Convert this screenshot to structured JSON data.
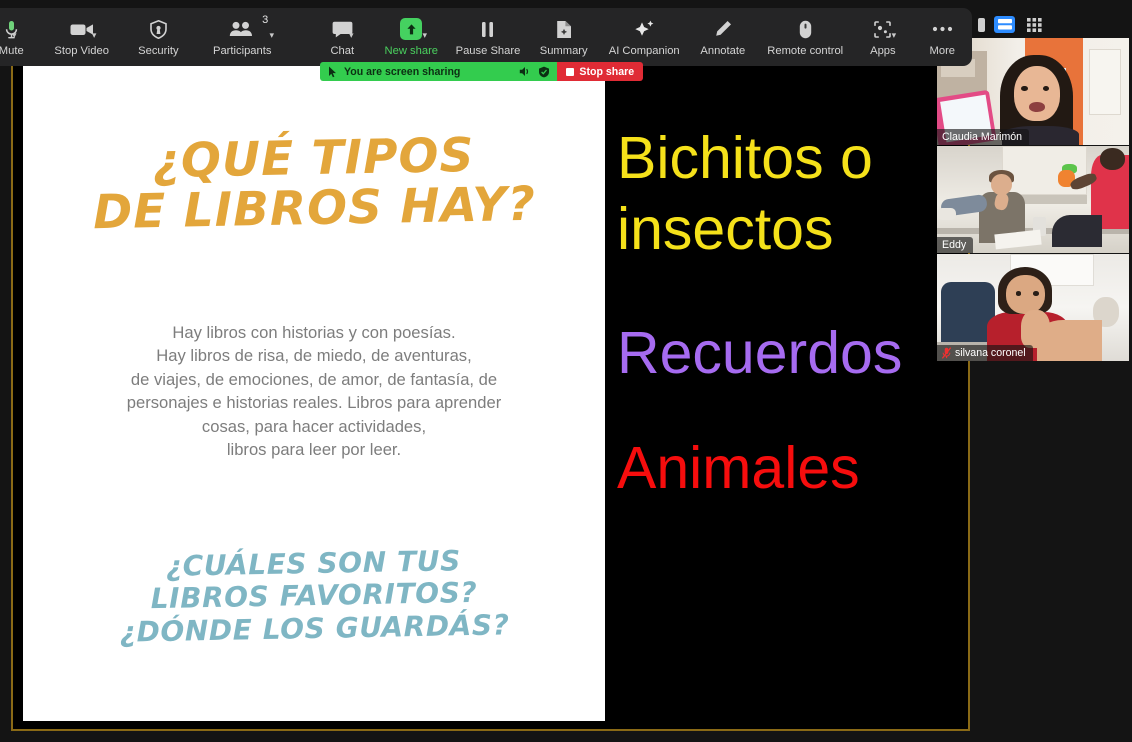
{
  "toolbar": {
    "items": [
      {
        "label": "Mute",
        "icon": "microphone-icon",
        "has_caret": true,
        "name": "mute"
      },
      {
        "label": "Stop Video",
        "icon": "video-camera-icon",
        "has_caret": true,
        "name": "stop-video"
      },
      {
        "label": "Security",
        "icon": "shield-icon",
        "has_caret": false,
        "name": "security"
      },
      {
        "label": "Participants",
        "icon": "people-icon",
        "has_caret": true,
        "badge": "3",
        "name": "participants"
      },
      {
        "label": "Chat",
        "icon": "chat-bubble-icon",
        "has_caret": true,
        "name": "chat"
      },
      {
        "label": "New share",
        "icon": "share-screen-icon",
        "has_caret": true,
        "highlight": true,
        "name": "new-share"
      },
      {
        "label": "Pause Share",
        "icon": "pause-icon",
        "has_caret": false,
        "name": "pause-share"
      },
      {
        "label": "Summary",
        "icon": "summary-document-icon",
        "has_caret": false,
        "name": "summary"
      },
      {
        "label": "AI Companion",
        "icon": "sparkle-icon",
        "has_caret": false,
        "name": "ai-companion"
      },
      {
        "label": "Annotate",
        "icon": "pencil-icon",
        "has_caret": false,
        "name": "annotate"
      },
      {
        "label": "Remote control",
        "icon": "mouse-icon",
        "has_caret": false,
        "name": "remote-control"
      },
      {
        "label": "Apps",
        "icon": "apps-icon",
        "has_caret": true,
        "name": "apps"
      },
      {
        "label": "More",
        "icon": "ellipsis-icon",
        "has_caret": false,
        "name": "more"
      }
    ]
  },
  "share_pill": {
    "status_text": "You are screen sharing",
    "stop_label": "Stop share"
  },
  "view_controls": {
    "speaker_view_label": "Speaker View",
    "gallery_view_label": "Gallery View",
    "active": "speaker",
    "accent_color": "#2d8cff"
  },
  "slide": {
    "title": "¿QUÉ TIPOS\nDE LIBROS HAY?",
    "title_color": "#e3a63b",
    "body": "Hay libros con historias y con poesías.\nHay libros de risa, de miedo, de aventuras,\nde viajes, de emociones, de amor, de fantasía, de\npersonajes e historias reales. Libros para aprender\ncosas, para hacer actividades,\nlibros para leer por leer.",
    "body_color": "#7d7d7d",
    "question": "¿CUÁLES SON TUS\nLIBROS FAVORITOS?\n¿DÓNDE LOS GUARDÁS?",
    "question_color": "#7fb6c4"
  },
  "black_panel": {
    "lines": [
      {
        "text": "Bichitos o\ninsectos",
        "color": "#f5e11a"
      },
      {
        "text": "Recuerdos",
        "color": "#a66bf0"
      },
      {
        "text": "Animales",
        "color": "#f60d0d"
      }
    ]
  },
  "participants": [
    {
      "name": "Claudia Marimón",
      "muted": false,
      "active_speaker": true
    },
    {
      "name": "Eddy",
      "muted": false,
      "active_speaker": false
    },
    {
      "name": "silvana coronel",
      "muted": true,
      "active_speaker": false
    }
  ],
  "share_frame": {
    "border_color": "#8a6a16"
  }
}
